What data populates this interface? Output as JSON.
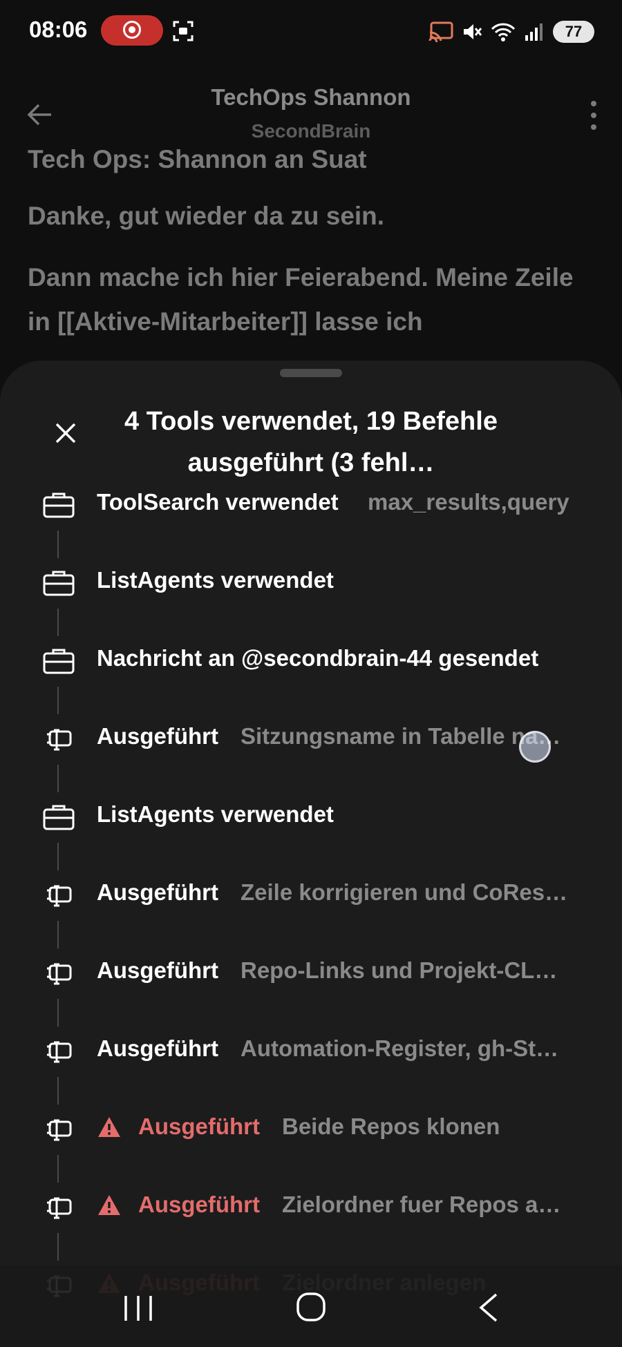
{
  "status_bar": {
    "time": "08:06",
    "battery": "77",
    "icons": [
      "screen-record-icon",
      "screenshot-icon",
      "cast-icon",
      "mute-icon",
      "wifi-icon",
      "signal-icon",
      "battery-icon"
    ]
  },
  "header": {
    "title": "TechOps Shannon",
    "subtitle": "SecondBrain"
  },
  "chat": {
    "heading": "Tech Ops: Shannon an Suat",
    "paragraph1": "Danke, gut wieder da zu sein.",
    "paragraph2": "Dann mache ich hier Feierabend. Meine Zeile in [[Aktive-Mitarbeiter]] lasse ich"
  },
  "sheet": {
    "title": "4 Tools verwendet, 19 Befehle ausgeführt (3 fehl…",
    "items": [
      {
        "icon": "toolbox-icon",
        "label": "ToolSearch verwendet",
        "detail": "max_results,query",
        "error": false
      },
      {
        "icon": "toolbox-icon",
        "label": "ListAgents verwendet",
        "detail": "",
        "error": false
      },
      {
        "icon": "toolbox-icon",
        "label": "Nachricht an @secondbrain-44 gesendet",
        "detail": "",
        "error": false
      },
      {
        "icon": "terminal-icon",
        "label": "Ausgeführt",
        "detail": "Sitzungsname in Tabelle na…",
        "error": false
      },
      {
        "icon": "toolbox-icon",
        "label": "ListAgents verwendet",
        "detail": "",
        "error": false
      },
      {
        "icon": "terminal-icon",
        "label": "Ausgeführt",
        "detail": "Zeile korrigieren und CoRes…",
        "error": false
      },
      {
        "icon": "terminal-icon",
        "label": "Ausgeführt",
        "detail": "Repo-Links und Projekt-CL…",
        "error": false
      },
      {
        "icon": "terminal-icon",
        "label": "Ausgeführt",
        "detail": "Automation-Register, gh-St…",
        "error": false
      },
      {
        "icon": "terminal-icon",
        "label": "Ausgeführt",
        "detail": "Beide Repos klonen",
        "error": true
      },
      {
        "icon": "terminal-icon",
        "label": "Ausgeführt",
        "detail": "Zielordner fuer Repos a…",
        "error": true
      },
      {
        "icon": "terminal-icon",
        "label": "Ausgeführt",
        "detail": "Zielordner anlegen",
        "error": true
      }
    ]
  },
  "colors": {
    "background": "#0f0f0f",
    "sheet": "#1c1c1c",
    "error": "#e46c6c",
    "detail_text": "#8a8a8a",
    "record_pill": "#c6302c"
  }
}
